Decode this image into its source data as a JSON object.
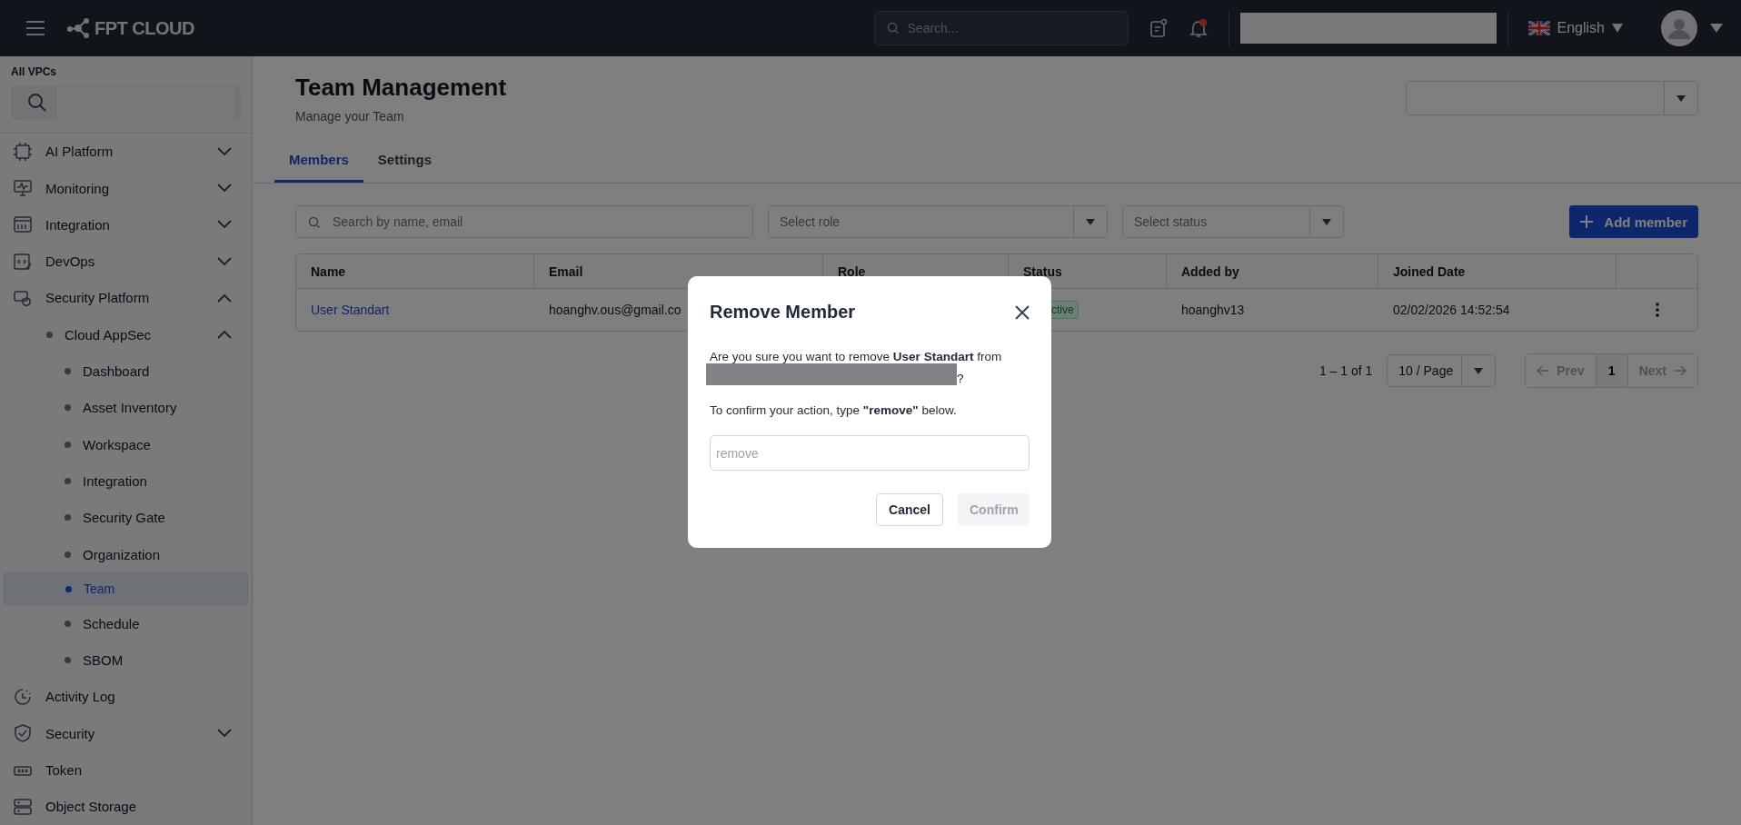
{
  "topbar": {
    "logo": "FPT CLOUD",
    "search": {
      "placeholder": "Search..."
    },
    "notifications": {
      "unread": true
    },
    "language": "English"
  },
  "sidebar": {
    "label": "All VPCs",
    "items": [
      {
        "label": "AI Platform",
        "selected": false,
        "expanded": false
      },
      {
        "label": "Monitoring",
        "selected": false,
        "expanded": false
      },
      {
        "label": "Integration",
        "selected": false,
        "expanded": false
      },
      {
        "label": "DevOps",
        "selected": false,
        "expanded": false
      },
      {
        "label": "Security Platform",
        "selected": false,
        "expanded": true,
        "children": [
          {
            "label": "Cloud AppSec",
            "selected": false,
            "expanded": true,
            "children": [
              {
                "label": "Dashboard",
                "selected": false
              },
              {
                "label": "Asset Inventory",
                "selected": false
              },
              {
                "label": "Workspace",
                "selected": false
              },
              {
                "label": "Integration",
                "selected": false
              },
              {
                "label": "Security Gate",
                "selected": false
              },
              {
                "label": "Organization",
                "selected": false
              },
              {
                "label": "Team",
                "selected": true
              },
              {
                "label": "Schedule",
                "selected": false
              },
              {
                "label": "SBOM",
                "selected": false
              }
            ]
          }
        ]
      },
      {
        "label": "Activity Log",
        "selected": false
      },
      {
        "label": "Security",
        "selected": false,
        "expanded": false
      },
      {
        "label": "Token",
        "selected": false
      },
      {
        "label": "Object Storage",
        "selected": false
      }
    ]
  },
  "page": {
    "title": "Team Management",
    "subtitle": "Manage your Team",
    "tabs": [
      {
        "label": "Members",
        "selected": true
      },
      {
        "label": "Settings",
        "selected": false
      }
    ],
    "filters": {
      "search_placeholder": "Search by name, email",
      "role_placeholder": "Select role",
      "status_placeholder": "Select status"
    },
    "add_button": "Add member",
    "table": {
      "columns": [
        "Name",
        "Email",
        "Role",
        "Status",
        "Added by",
        "Joined Date"
      ],
      "rows": [
        {
          "name": "User Standart",
          "email": "hoanghv.ous@gmail.co",
          "status": "ctive",
          "added_by": "hoanghv13",
          "joined": "02/02/2026 14:52:54"
        }
      ]
    },
    "pagination": {
      "range": "1 – 1 of 1",
      "page_size": "10 / Page",
      "prev": "Prev",
      "pages": [
        {
          "label": "1",
          "selected": true
        }
      ],
      "next": "Next"
    }
  },
  "modal": {
    "title": "Remove Member",
    "message": "Are you sure you want to remove **User Standart** from",
    "message_end": "?",
    "instruction": "To confirm your action, type **\"remove\"** below.",
    "input_placeholder": "remove",
    "cancel": "Cancel",
    "confirm": {
      "label": "Confirm",
      "disabled": true
    }
  }
}
